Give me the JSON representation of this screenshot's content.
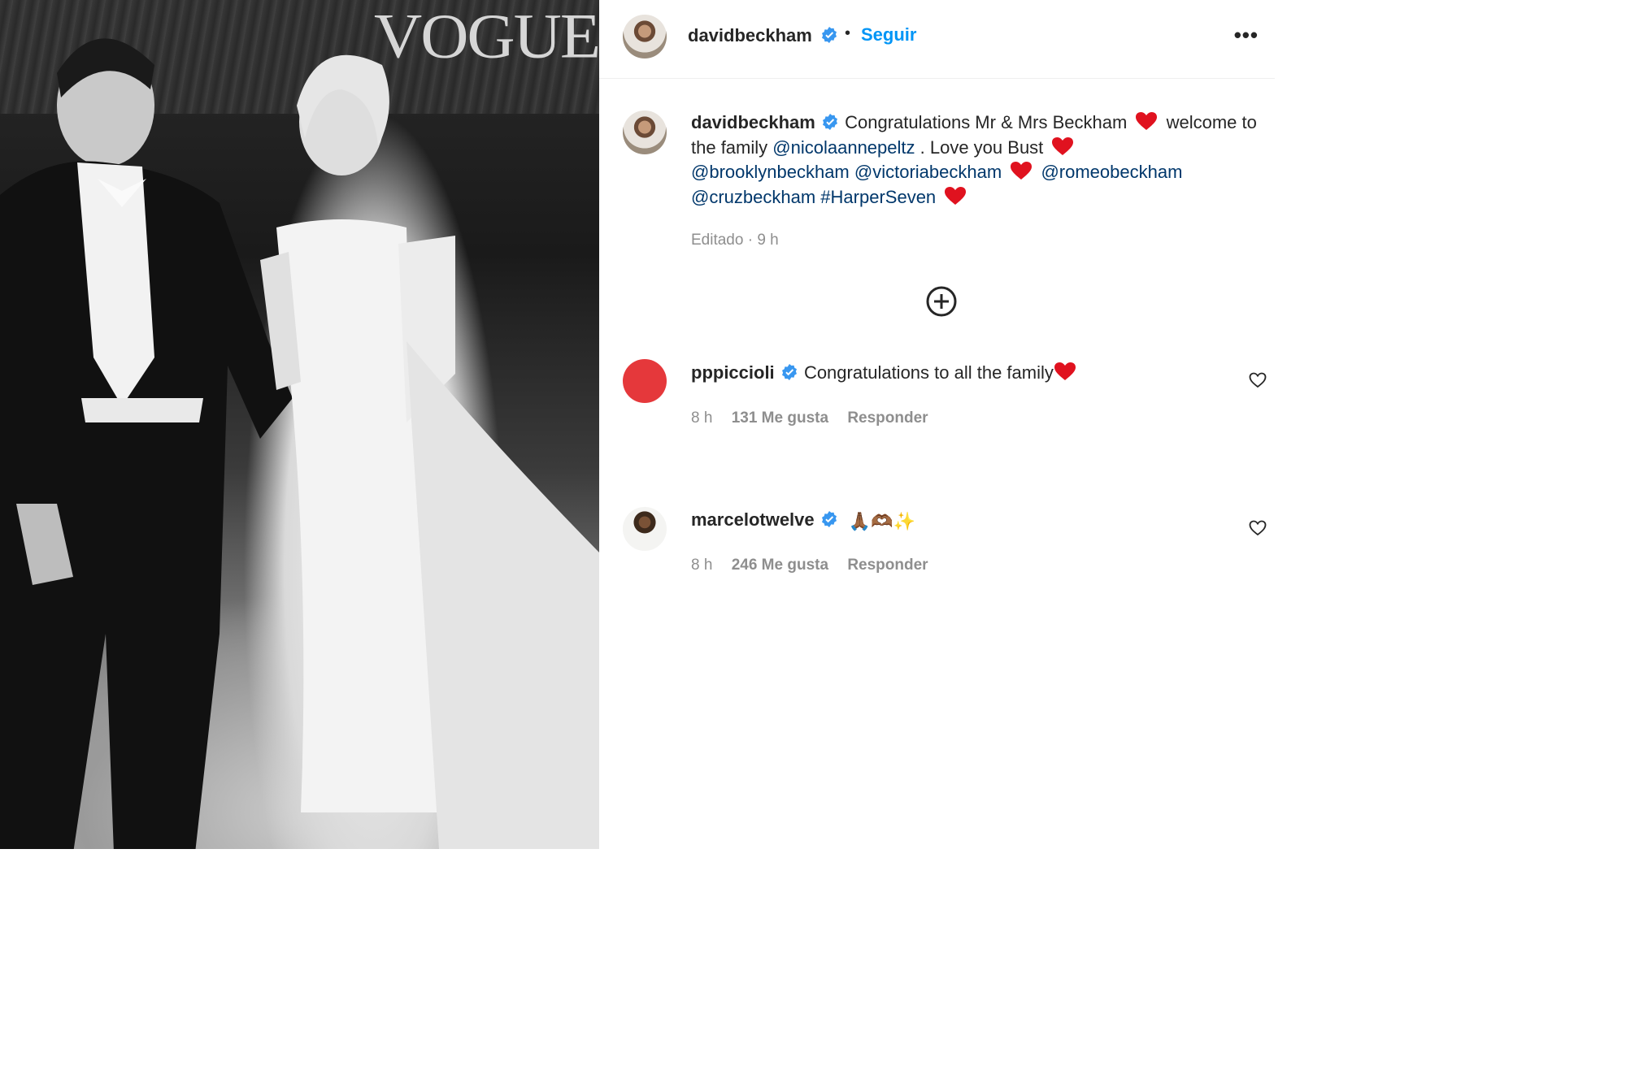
{
  "photo": {
    "magazine_logo": "VOGUE"
  },
  "header": {
    "username": "davidbeckham",
    "separator": "•",
    "follow_label": "Seguir",
    "more_label": "•••"
  },
  "caption": {
    "username": "davidbeckham",
    "text_1": "Congratulations Mr & Mrs Beckham",
    "text_2": "welcome to the family",
    "mention_1": "@nicolaannepeltz",
    "text_3": ". Love you Bust",
    "mention_2": "@brooklynbeckham",
    "mention_3": "@victoriabeckham",
    "mention_4": "@romeobeckham",
    "mention_5": "@cruzbeckham",
    "hashtag": "#HarperSeven",
    "meta": "Editado · 9 h"
  },
  "comments": [
    {
      "username": "pppiccioli",
      "text": "Congratulations to all the family",
      "time": "8 h",
      "likes": "131 Me gusta",
      "reply": "Responder"
    },
    {
      "username": "marcelotwelve",
      "text": "🙏🏾🫶🏾✨",
      "time": "8 h",
      "likes": "246 Me gusta",
      "reply": "Responder"
    }
  ],
  "colors": {
    "link": "#00376b",
    "follow": "#0095f6",
    "verified": "#3897f0",
    "heart": "#e0121f",
    "muted": "#8e8e8e"
  },
  "icons": {
    "verified": "verified-badge-icon",
    "heart": "red-heart-icon",
    "load_more": "plus-circle-icon",
    "like": "heart-outline-icon",
    "more": "more-options-icon"
  }
}
